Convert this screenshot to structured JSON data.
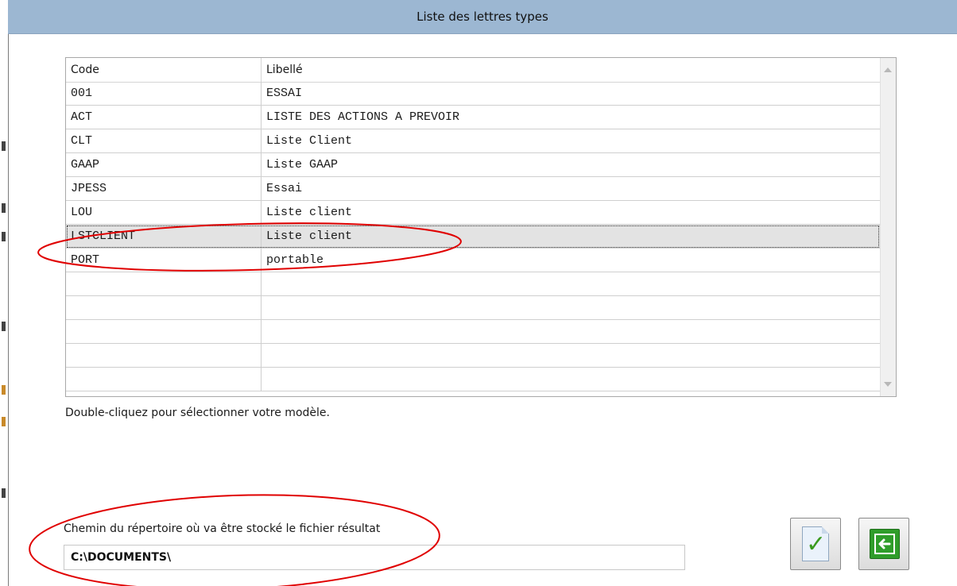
{
  "window": {
    "title": "Liste des lettres types"
  },
  "list": {
    "columns": {
      "code": "Code",
      "label": "Libellé"
    },
    "rows": [
      {
        "code": "001",
        "label": "ESSAI"
      },
      {
        "code": "ACT",
        "label": "LISTE DES ACTIONS A PREVOIR"
      },
      {
        "code": "CLT",
        "label": "Liste Client"
      },
      {
        "code": "GAAP",
        "label": "Liste GAAP"
      },
      {
        "code": "JPESS",
        "label": "Essai"
      },
      {
        "code": "LOU",
        "label": "Liste client"
      },
      {
        "code": "LSTCLIENT",
        "label": "Liste client"
      },
      {
        "code": "PORT",
        "label": "portable"
      },
      {
        "code": "",
        "label": ""
      },
      {
        "code": "",
        "label": ""
      },
      {
        "code": "",
        "label": ""
      },
      {
        "code": "",
        "label": ""
      },
      {
        "code": "",
        "label": ""
      }
    ],
    "selected_code": "LSTCLIENT"
  },
  "hint": "Double-cliquez pour sélectionner votre modèle.",
  "path": {
    "label": "Chemin du répertoire où va être stocké le fichier résultat",
    "value": "C:\\DOCUMENTS\\"
  },
  "buttons": {
    "validate_icon": "check-document-icon",
    "back_icon": "arrow-left-icon"
  },
  "colors": {
    "titlebar": "#9cb7d2",
    "annotation": "#e00000",
    "back_button": "#2f9d2a"
  }
}
